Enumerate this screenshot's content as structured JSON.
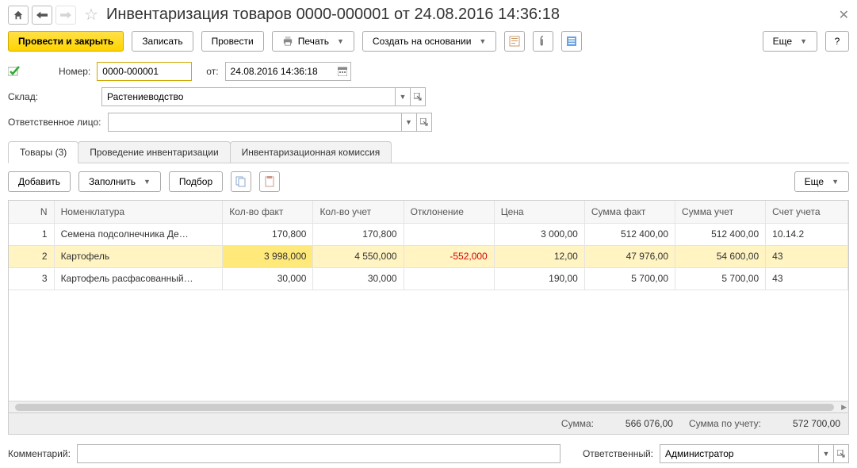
{
  "title": "Инвентаризация товаров 0000-000001 от 24.08.2016 14:36:18",
  "toolbar": {
    "post_close": "Провести и закрыть",
    "write": "Записать",
    "post": "Провести",
    "print": "Печать",
    "create_from": "Создать на основании",
    "more": "Еще",
    "help": "?"
  },
  "form": {
    "number_label": "Номер:",
    "number": "0000-000001",
    "date_label": "от:",
    "date": "24.08.2016 14:36:18",
    "warehouse_label": "Склад:",
    "warehouse": "Растениеводство",
    "responsible_label": "Ответственное лицо:",
    "responsible": ""
  },
  "tabs": {
    "goods": "Товары (3)",
    "conduct": "Проведение инвентаризации",
    "commission": "Инвентаризационная комиссия"
  },
  "subtoolbar": {
    "add": "Добавить",
    "fill": "Заполнить",
    "pick": "Подбор",
    "more": "Еще"
  },
  "table": {
    "headers": {
      "n": "N",
      "nomen": "Номенклатура",
      "qty_fact": "Кол-во факт",
      "qty_acc": "Кол-во учет",
      "delta": "Отклонение",
      "price": "Цена",
      "sum_fact": "Сумма факт",
      "sum_acc": "Сумма учет",
      "account": "Счет учета"
    },
    "rows": [
      {
        "n": "1",
        "nomen": "Семена подсолнечника Де…",
        "qty_fact": "170,800",
        "qty_acc": "170,800",
        "delta": "",
        "price": "3 000,00",
        "sum_fact": "512 400,00",
        "sum_acc": "512 400,00",
        "account": "10.14.2"
      },
      {
        "n": "2",
        "nomen": "Картофель",
        "qty_fact": "3 998,000",
        "qty_acc": "4 550,000",
        "delta": "-552,000",
        "price": "12,00",
        "sum_fact": "47 976,00",
        "sum_acc": "54 600,00",
        "account": "43"
      },
      {
        "n": "3",
        "nomen": "Картофель расфасованный…",
        "qty_fact": "30,000",
        "qty_acc": "30,000",
        "delta": "",
        "price": "190,00",
        "sum_fact": "5 700,00",
        "sum_acc": "5 700,00",
        "account": "43"
      }
    ]
  },
  "totals": {
    "sum_label": "Сумма:",
    "sum": "566 076,00",
    "sum_acc_label": "Сумма по учету:",
    "sum_acc": "572 700,00"
  },
  "footer": {
    "comment_label": "Комментарий:",
    "comment": "",
    "responsible_label": "Ответственный:",
    "responsible": "Администратор"
  }
}
